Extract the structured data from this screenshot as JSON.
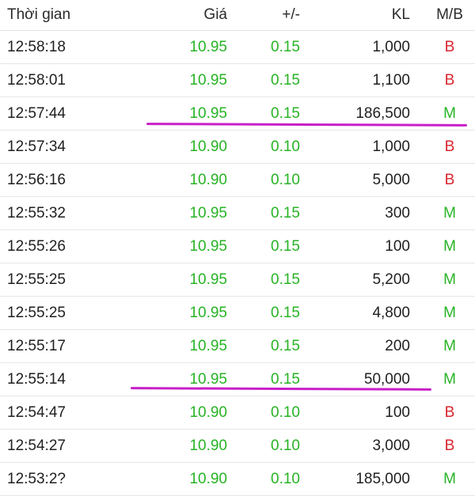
{
  "columns": {
    "time": "Thời gian",
    "price": "Giá",
    "change": "+/-",
    "volume": "KL",
    "side": "M/B"
  },
  "rows": [
    {
      "time": "12:58:18",
      "price": "10.95",
      "change": "0.15",
      "volume": "1,000",
      "side": "B"
    },
    {
      "time": "12:58:01",
      "price": "10.95",
      "change": "0.15",
      "volume": "1,100",
      "side": "B"
    },
    {
      "time": "12:57:44",
      "price": "10.95",
      "change": "0.15",
      "volume": "186,500",
      "side": "M"
    },
    {
      "time": "12:57:34",
      "price": "10.90",
      "change": "0.10",
      "volume": "1,000",
      "side": "B"
    },
    {
      "time": "12:56:16",
      "price": "10.90",
      "change": "0.10",
      "volume": "5,000",
      "side": "B"
    },
    {
      "time": "12:55:32",
      "price": "10.95",
      "change": "0.15",
      "volume": "300",
      "side": "M"
    },
    {
      "time": "12:55:26",
      "price": "10.95",
      "change": "0.15",
      "volume": "100",
      "side": "M"
    },
    {
      "time": "12:55:25",
      "price": "10.95",
      "change": "0.15",
      "volume": "5,200",
      "side": "M"
    },
    {
      "time": "12:55:25",
      "price": "10.95",
      "change": "0.15",
      "volume": "4,800",
      "side": "M"
    },
    {
      "time": "12:55:17",
      "price": "10.95",
      "change": "0.15",
      "volume": "200",
      "side": "M"
    },
    {
      "time": "12:55:14",
      "price": "10.95",
      "change": "0.15",
      "volume": "50,000",
      "side": "M"
    },
    {
      "time": "12:54:47",
      "price": "10.90",
      "change": "0.10",
      "volume": "100",
      "side": "B"
    },
    {
      "time": "12:54:27",
      "price": "10.90",
      "change": "0.10",
      "volume": "3,000",
      "side": "B"
    },
    {
      "time": "12:53:2?",
      "price": "10.90",
      "change": "0.10",
      "volume": "185,000",
      "side": "M"
    }
  ],
  "colors": {
    "up_green": "#27b324",
    "sell_red": "#d9262f",
    "annotation_magenta": "#c81fc8"
  }
}
